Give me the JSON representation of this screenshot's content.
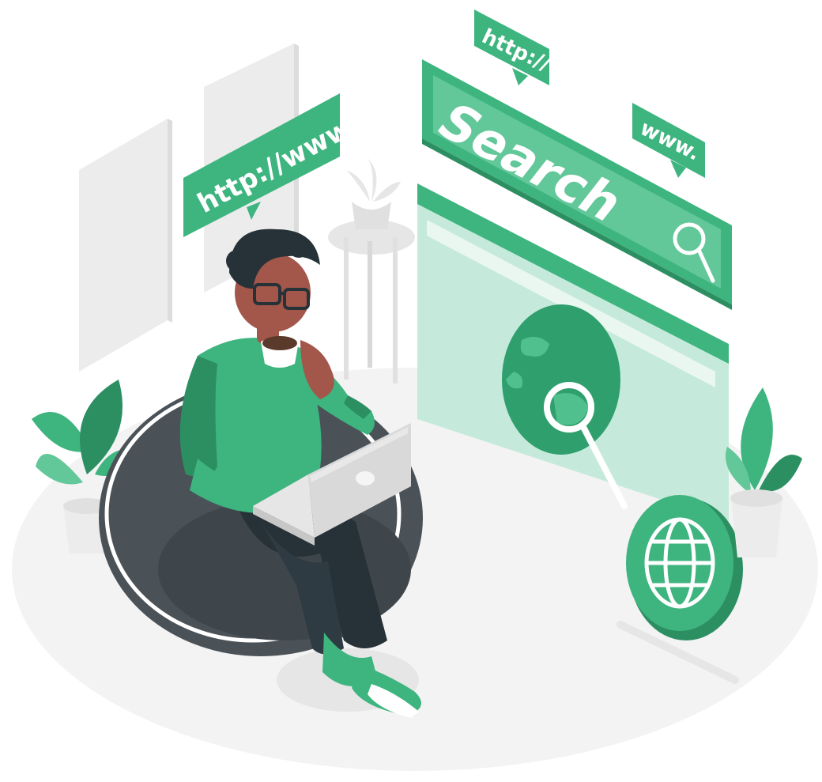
{
  "bubbles": {
    "left_url": "http://www.",
    "top_url": "http://",
    "right_url": "www."
  },
  "search_bar": {
    "label": "Search"
  },
  "icons": {
    "search": "magnifier-icon",
    "globe": "globe-icon",
    "map_globe": "world-map-icon"
  },
  "colors": {
    "accent": "#3eb47f",
    "accent_dark": "#2c8f62",
    "accent_light": "#a9dfc5",
    "panel": "#c8ebdb",
    "floor": "#f2f2f2",
    "beanbag": "#4a5258",
    "skin": "#a3564a"
  }
}
